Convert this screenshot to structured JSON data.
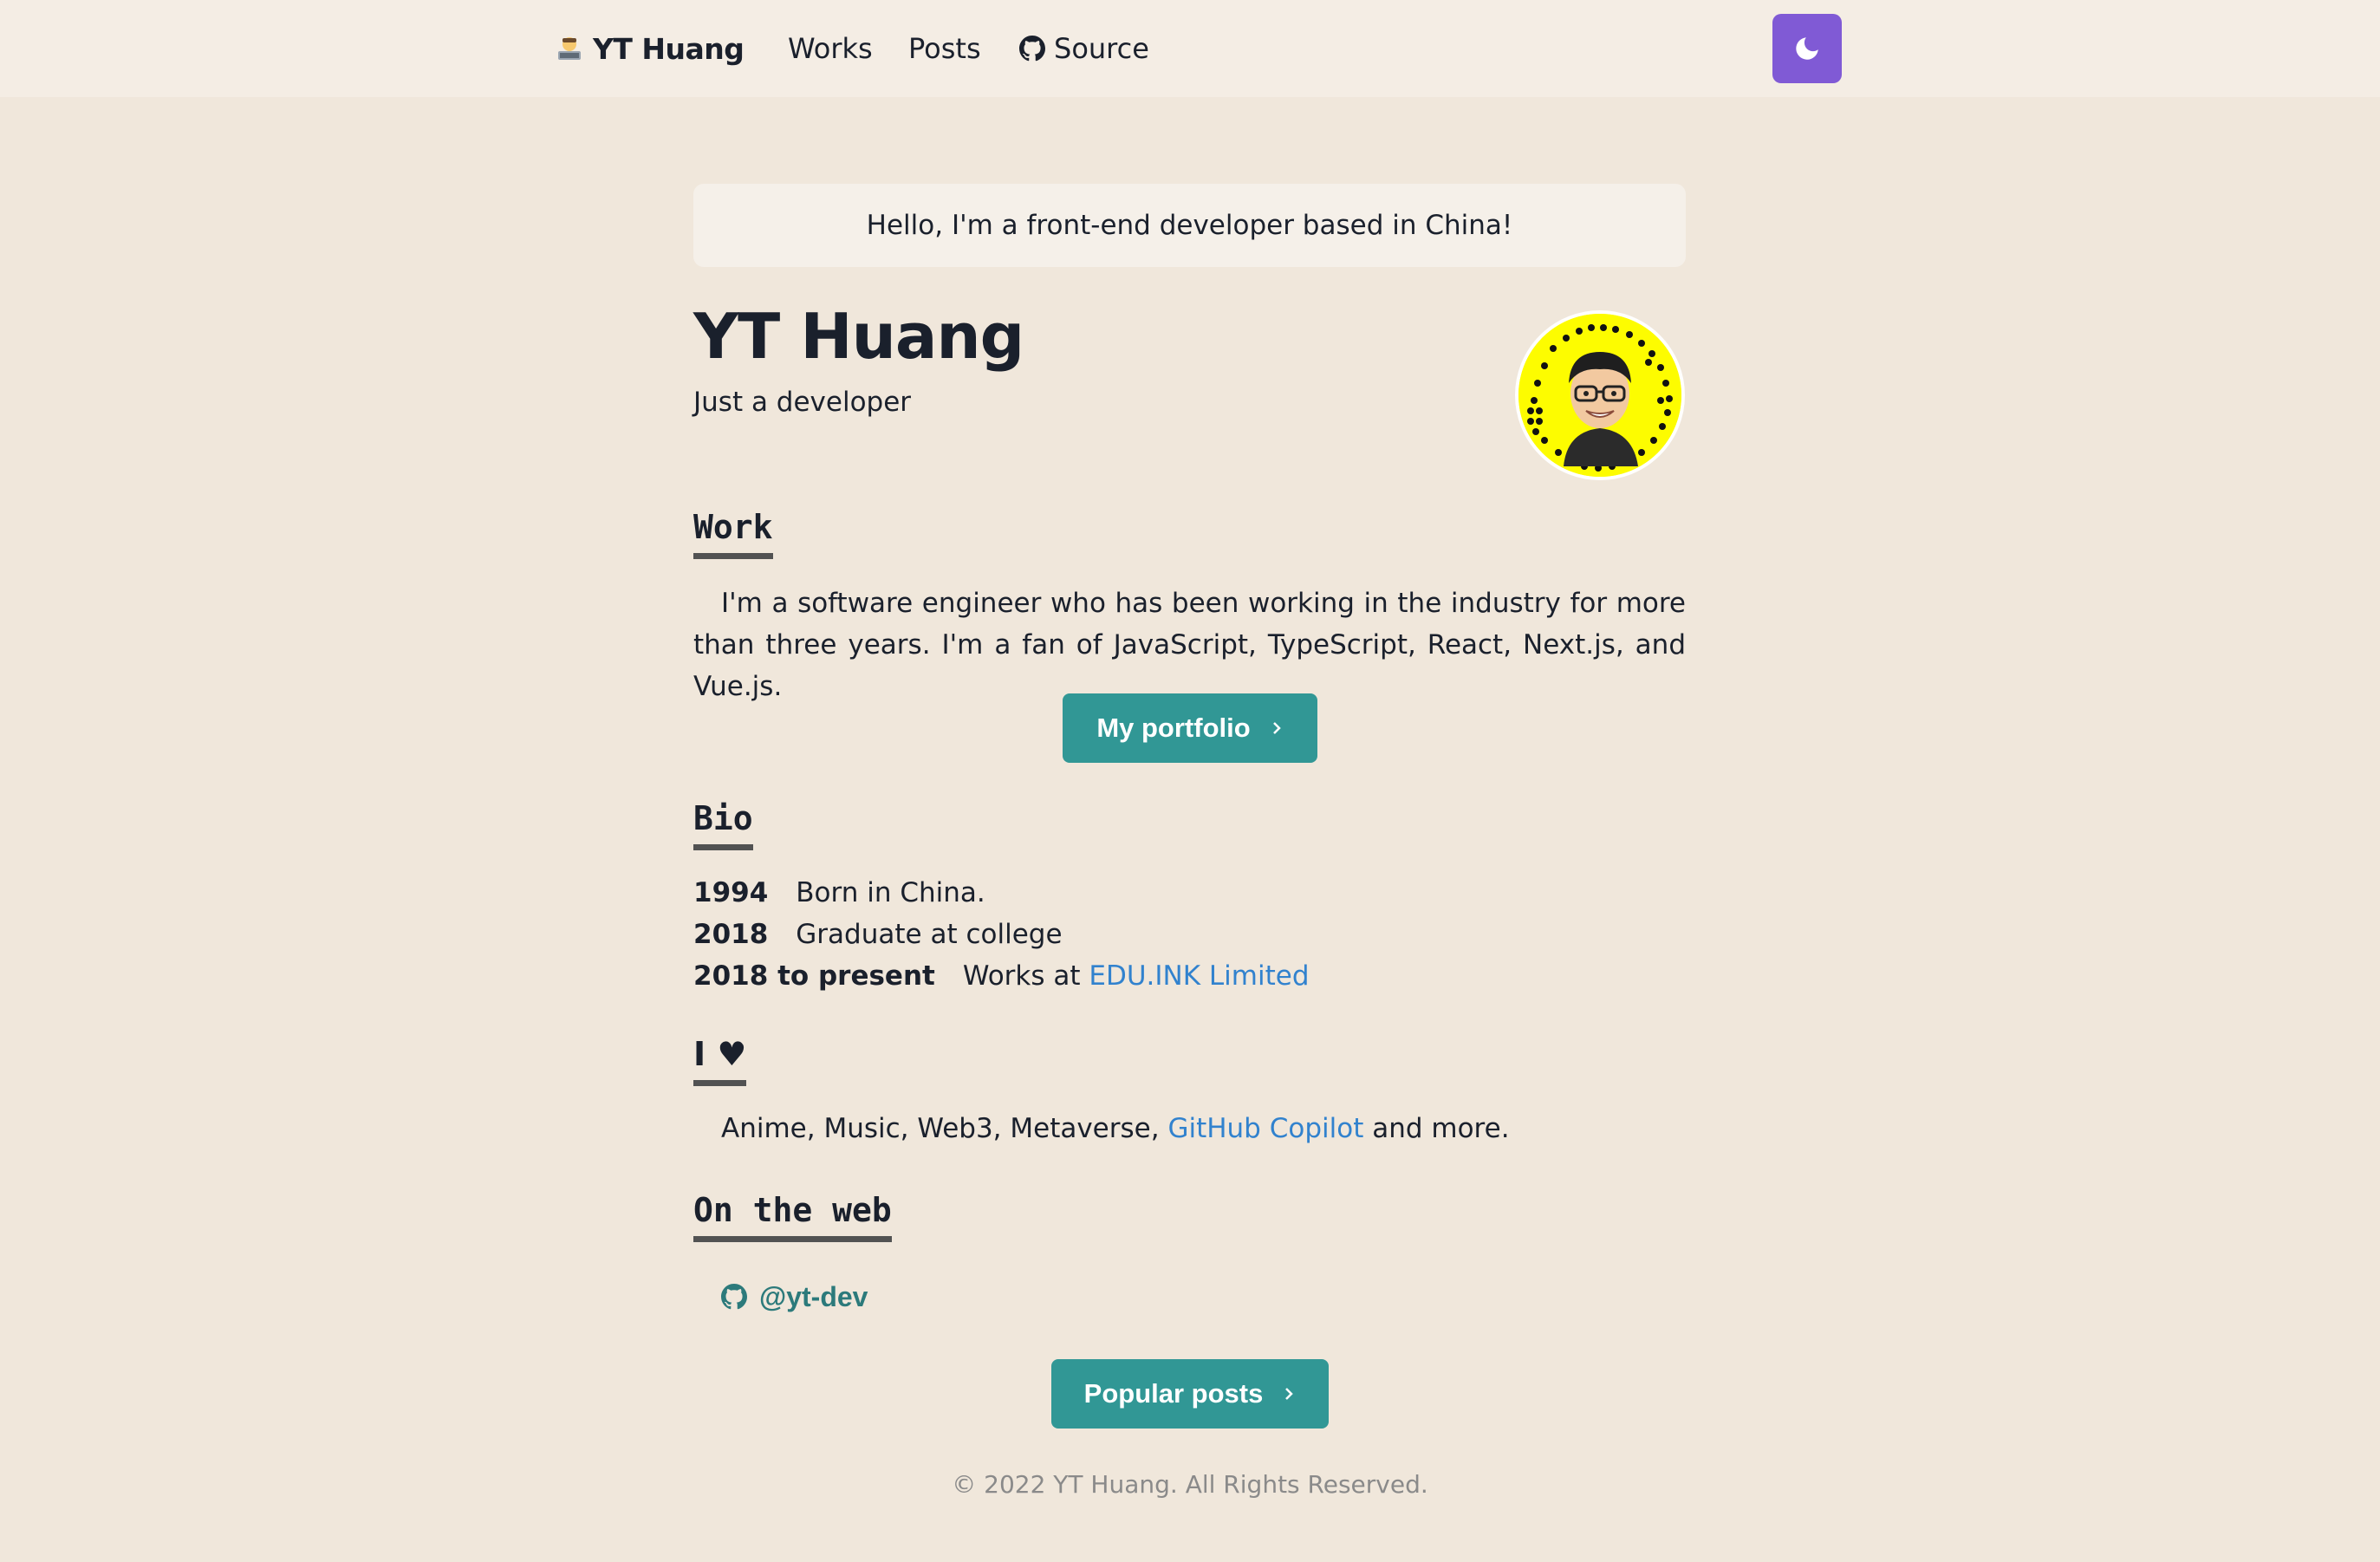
{
  "nav": {
    "logo_text": "YT Huang",
    "links": [
      {
        "label": "Works"
      },
      {
        "label": "Posts"
      },
      {
        "label": "Source"
      }
    ],
    "theme_toggle_icon": "moon-icon"
  },
  "intro": {
    "greeting": "Hello, I'm a front-end developer based in China!",
    "name": "YT Huang",
    "tagline": "Just a developer"
  },
  "work": {
    "title": "Work",
    "text": "I'm a software engineer who has been working in the industry for more than three years. I'm a fan of JavaScript, TypeScript, React, Next.js, and Vue.js.",
    "button_label": "My portfolio"
  },
  "bio": {
    "title": "Bio",
    "items": [
      {
        "year": "1994",
        "text": "Born in China.",
        "link": ""
      },
      {
        "year": "2018",
        "text": "Graduate at college",
        "link": ""
      },
      {
        "year": "2018 to present",
        "text": "Works at ",
        "link": "EDU.INK Limited"
      }
    ]
  },
  "love": {
    "title": "I ♥",
    "text_before": "Anime, Music, Web3, Metaverse, ",
    "link": "GitHub Copilot",
    "text_after": " and more."
  },
  "web": {
    "title": "On the web",
    "github_handle": "@yt-dev",
    "button_label": "Popular posts"
  },
  "footer": {
    "text": "© 2022 YT Huang. All Rights Reserved."
  },
  "colors": {
    "background": "#f0e7db",
    "accent_teal": "#319795",
    "accent_purple": "#805ad5",
    "link_blue": "#3182ce"
  }
}
